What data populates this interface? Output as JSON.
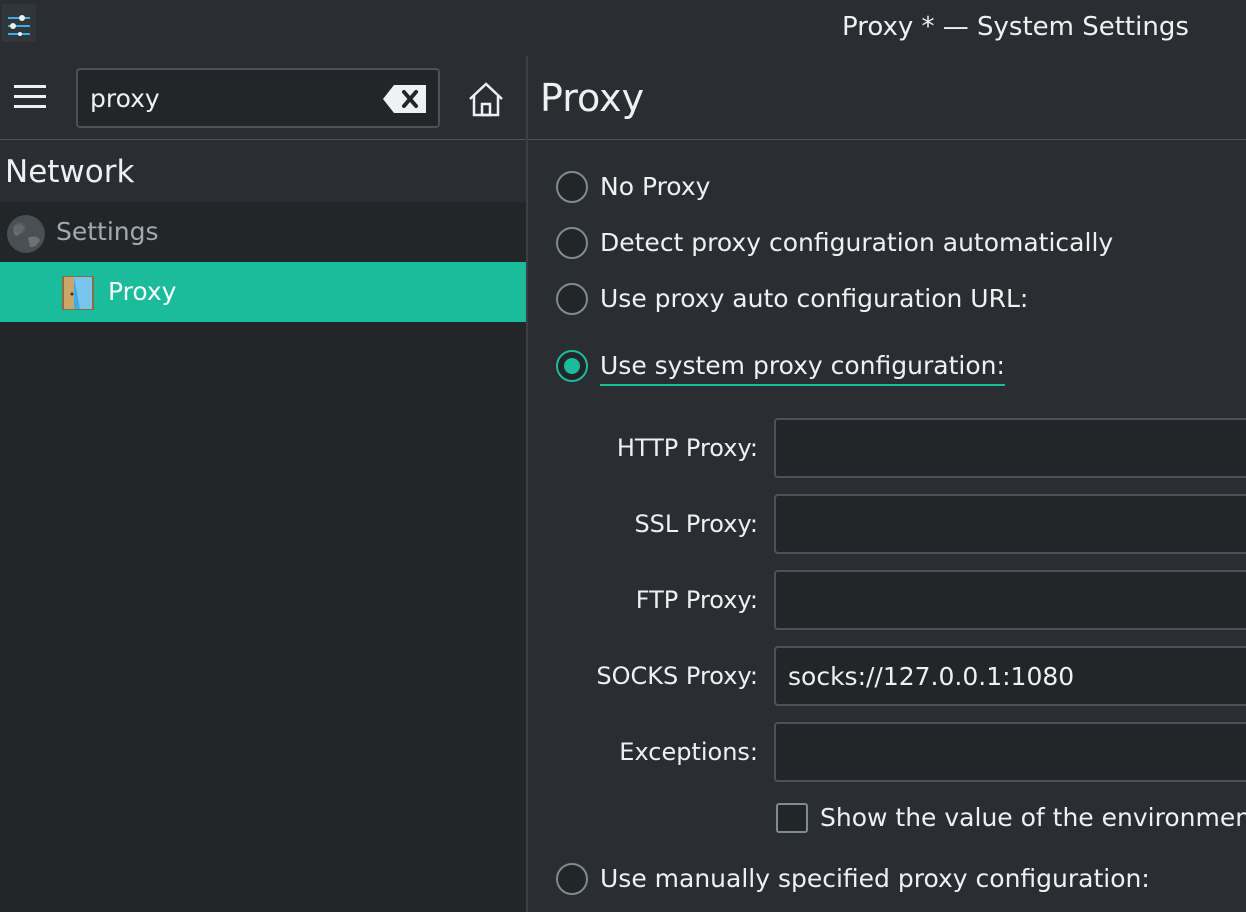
{
  "window": {
    "title": "Proxy * — System Settings",
    "app_icon": "settings-sliders-icon"
  },
  "sidebar": {
    "menu_icon": "hamburger-menu-icon",
    "search": {
      "value": "proxy",
      "placeholder": ""
    },
    "clear_icon": "backspace-clear-icon",
    "home_icon": "home-icon",
    "category": "Network",
    "items": [
      {
        "label": "Settings",
        "icon": "globe-icon",
        "selected": false
      },
      {
        "label": "Proxy",
        "icon": "proxy-door-icon",
        "selected": true
      }
    ]
  },
  "main": {
    "title": "Proxy",
    "options": [
      {
        "label": "No Proxy",
        "checked": false
      },
      {
        "label": "Detect proxy configuration automatically",
        "checked": false
      },
      {
        "label": "Use proxy auto configuration URL:",
        "checked": false
      },
      {
        "label": "Use system proxy configuration:",
        "checked": true
      },
      {
        "label": "Use manually specified proxy configuration:",
        "checked": false
      }
    ],
    "fields": [
      {
        "label": "HTTP Proxy:",
        "value": ""
      },
      {
        "label": "SSL Proxy:",
        "value": ""
      },
      {
        "label": "FTP Proxy:",
        "value": ""
      },
      {
        "label": "SOCKS Proxy:",
        "value": "socks://127.0.0.1:1080"
      },
      {
        "label": "Exceptions:",
        "value": ""
      }
    ],
    "show_env_checkbox": {
      "label": "Show the value of the environment",
      "checked": false
    }
  },
  "colors": {
    "accent": "#1abc9c",
    "background": "#2a2e32",
    "view_background": "#232629",
    "text": "#eff0f1"
  }
}
